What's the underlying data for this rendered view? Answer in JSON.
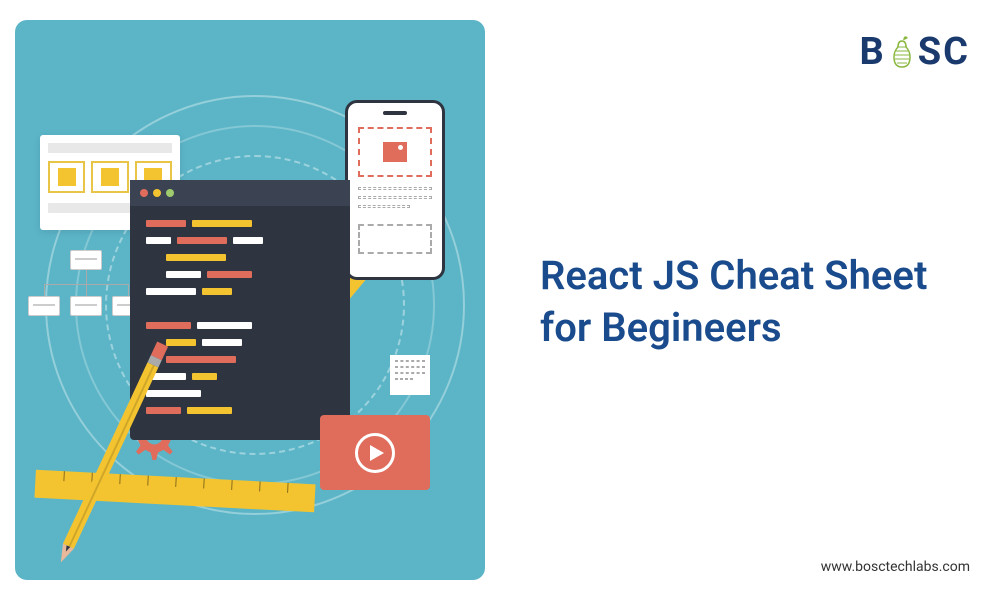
{
  "logo": {
    "text_before": "B",
    "text_after": "SC"
  },
  "title": "React JS Cheat Sheet for Begineers",
  "url": "www.bosctechlabs.com",
  "colors": {
    "bg_teal": "#5bb5c7",
    "brand_navy": "#1a4b8c",
    "yellow": "#f4c430",
    "orange": "#e06c5c",
    "dark": "#2e3440"
  }
}
